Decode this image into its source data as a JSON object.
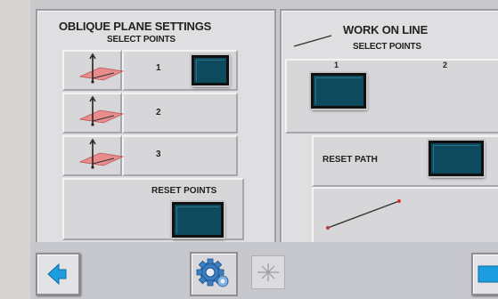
{
  "oblique": {
    "title": "OBLIQUE PLANE SETTINGS",
    "subtitle": "SELECT POINTS",
    "rows": [
      {
        "number": "1"
      },
      {
        "number": "2"
      },
      {
        "number": "3"
      }
    ],
    "reset_label": "RESET POINTS"
  },
  "work_on_line": {
    "title": "WORK ON LINE",
    "subtitle": "SELECT POINTS",
    "point1": "1",
    "point2": "2",
    "reset_path_label": "RESET PATH"
  },
  "colors": {
    "button_dark": "#0e4a5e",
    "nav_arrow": "#1e9ee0",
    "plane": "#e88c8c",
    "line": "#333333",
    "line_point": "#d33333"
  },
  "icons": {
    "back": "left-arrow-icon",
    "forward": "right-arrow-icon",
    "settings": "gear-icon",
    "asterisk": "asterisk-icon",
    "plane": "plane-axis-icon",
    "line": "line-icon"
  }
}
